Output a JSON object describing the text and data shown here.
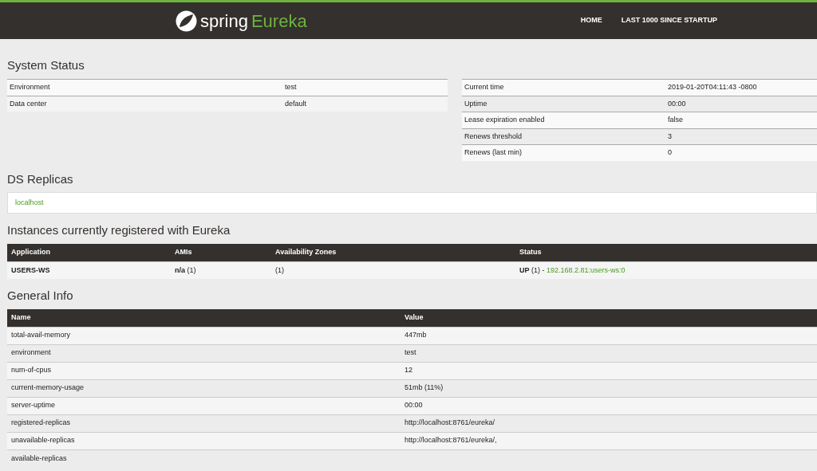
{
  "navbar": {
    "brand": "spring",
    "product": "Eureka",
    "links": [
      "HOME",
      "LAST 1000 SINCE STARTUP"
    ]
  },
  "system_status": {
    "title": "System Status",
    "left": [
      {
        "label": "Environment",
        "value": "test"
      },
      {
        "label": "Data center",
        "value": "default"
      }
    ],
    "right": [
      {
        "label": "Current time",
        "value": "2019-01-20T04:11:43 -0800"
      },
      {
        "label": "Uptime",
        "value": "00:00"
      },
      {
        "label": "Lease expiration enabled",
        "value": "false"
      },
      {
        "label": "Renews threshold",
        "value": "3"
      },
      {
        "label": "Renews (last min)",
        "value": "0"
      }
    ]
  },
  "ds_replicas": {
    "title": "DS Replicas",
    "items": [
      "localhost"
    ]
  },
  "instances": {
    "title": "Instances currently registered with Eureka",
    "columns": [
      "Application",
      "AMIs",
      "Availability Zones",
      "Status"
    ],
    "rows": [
      {
        "application": "USERS-WS",
        "amis": "**n/a** (1)",
        "zones": "(1)",
        "status": "**UP** (1) -",
        "instance_link": "192.168.2.81:users-ws:0"
      }
    ]
  },
  "general_info": {
    "title": "General Info",
    "columns": [
      "Name",
      "Value"
    ],
    "rows": [
      [
        "total-avail-memory",
        "447mb"
      ],
      [
        "environment",
        "test"
      ],
      [
        "num-of-cpus",
        "12"
      ],
      [
        "current-memory-usage",
        "51mb (11%)"
      ],
      [
        "server-uptime",
        "00:00"
      ],
      [
        "registered-replicas",
        "http://localhost:8761/eureka/"
      ],
      [
        "unavailable-replicas",
        "http://localhost:8761/eureka/,"
      ],
      [
        "available-replicas"
      ]
    ]
  }
}
